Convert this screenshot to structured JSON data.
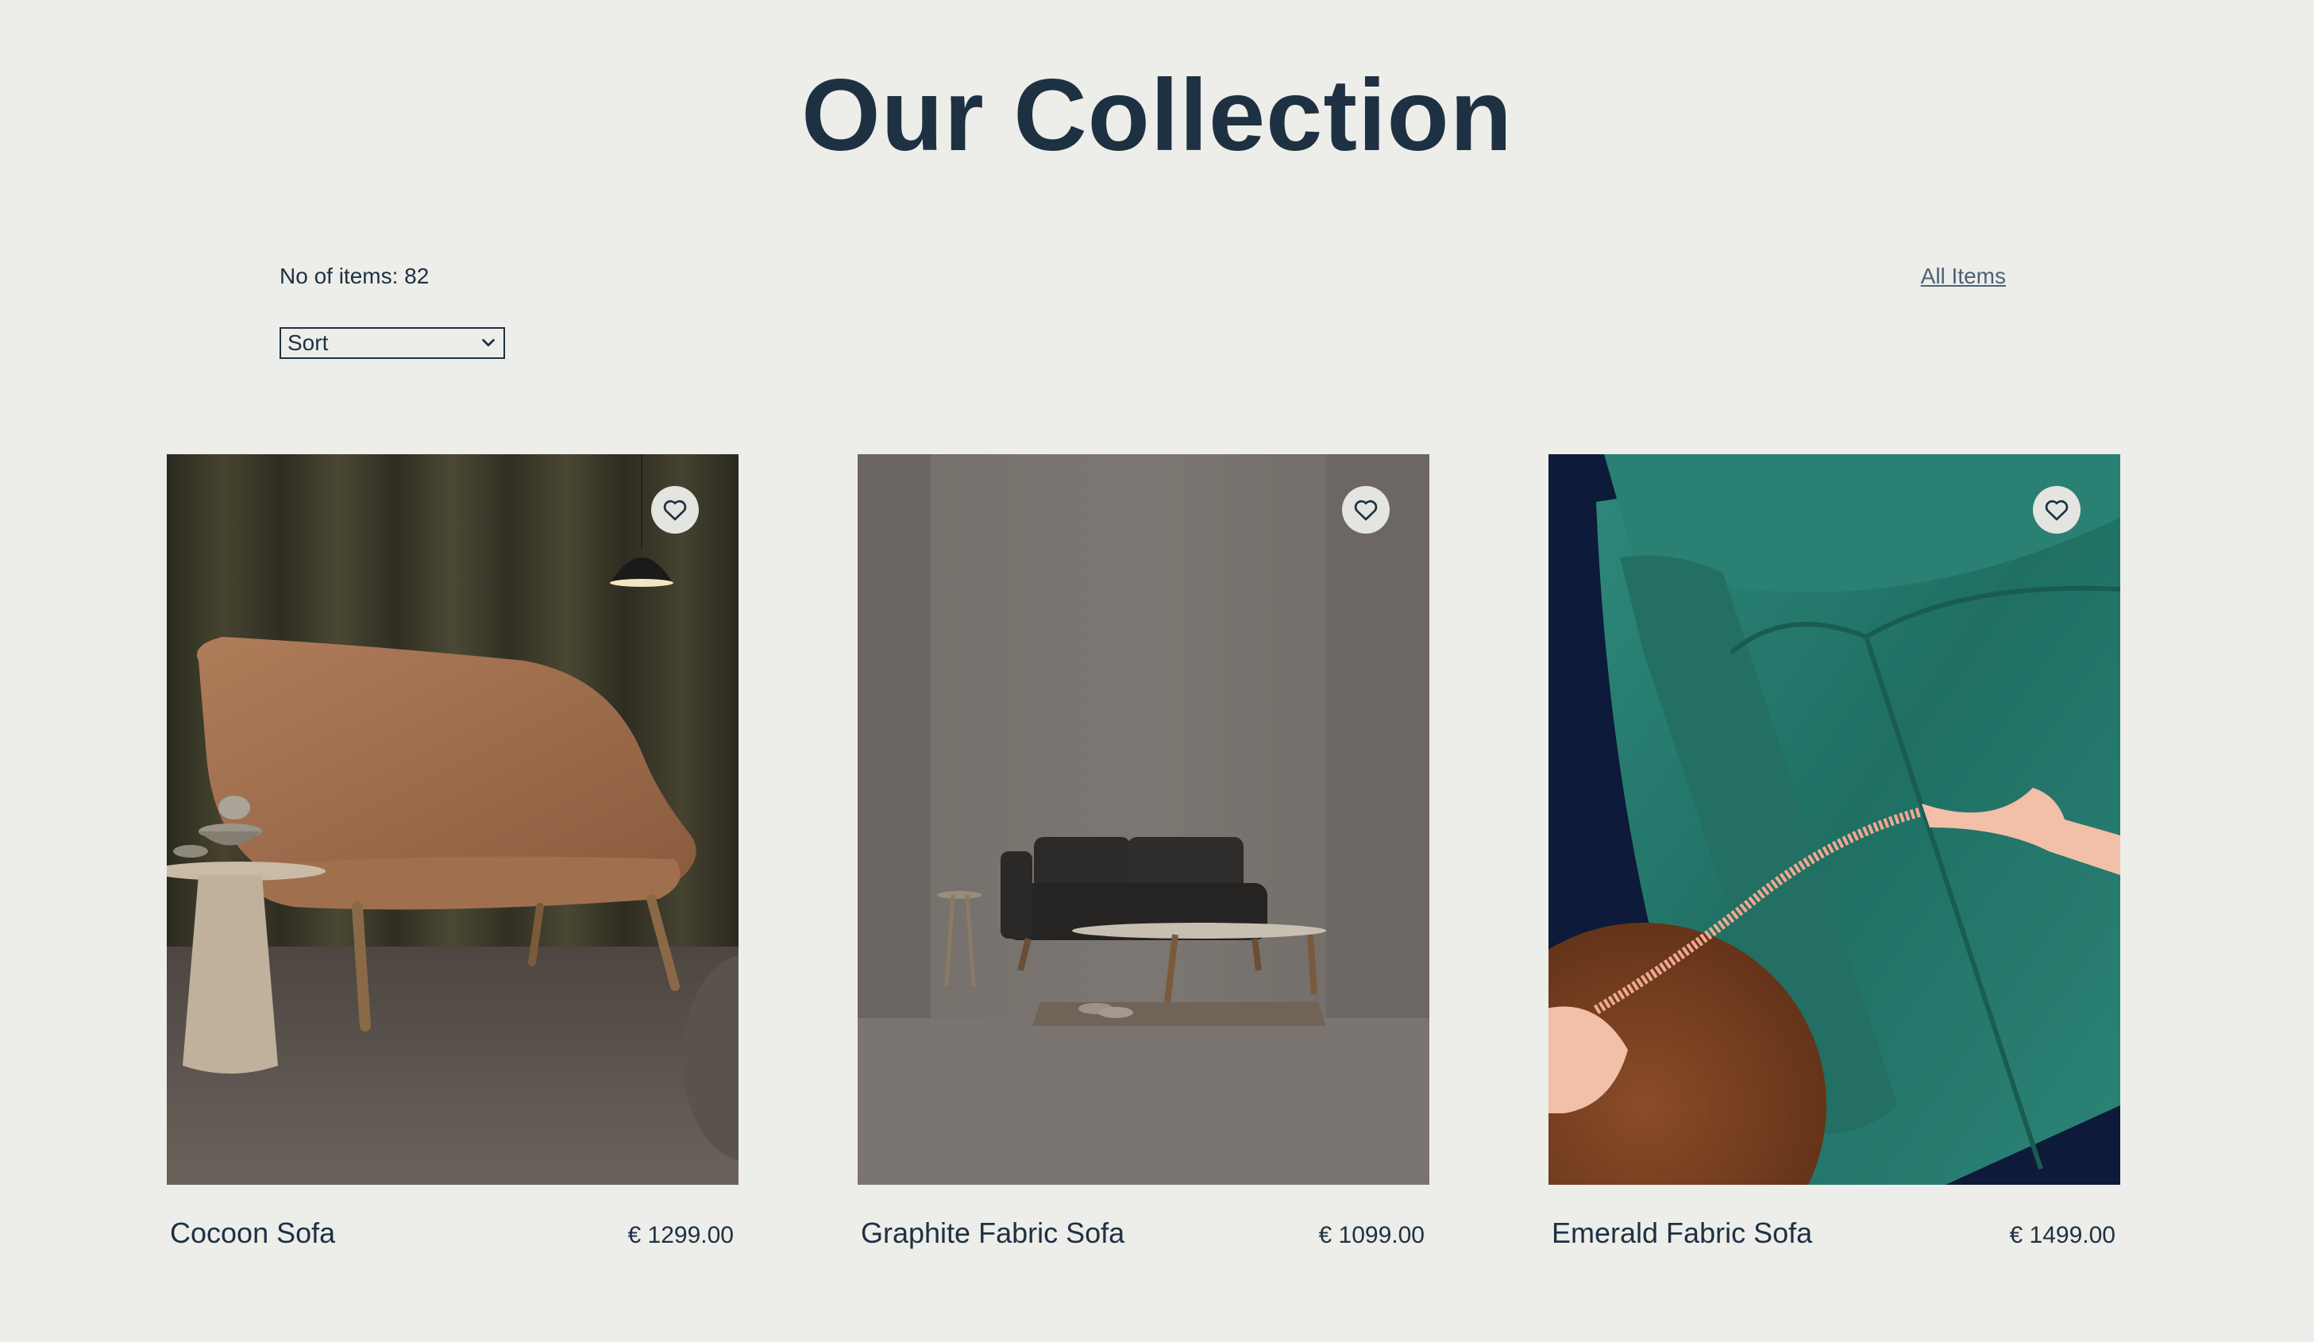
{
  "header": {
    "title": "Our Collection"
  },
  "toolbar": {
    "item_count": "No of items: 82",
    "all_items_link": "All Items",
    "sort_selected": "Sort"
  },
  "colors": {
    "background": "#EDEDE9",
    "primary_text": "#1D3142",
    "link": "#4A6378"
  },
  "products": [
    {
      "name": "Cocoon Sofa",
      "price": "€ 1299.00",
      "favorite_icon": "heart-outline-icon"
    },
    {
      "name": "Graphite Fabric Sofa",
      "price": "€ 1099.00",
      "favorite_icon": "heart-outline-icon"
    },
    {
      "name": "Emerald Fabric Sofa",
      "price": "€ 1499.00",
      "favorite_icon": "heart-outline-icon"
    }
  ]
}
